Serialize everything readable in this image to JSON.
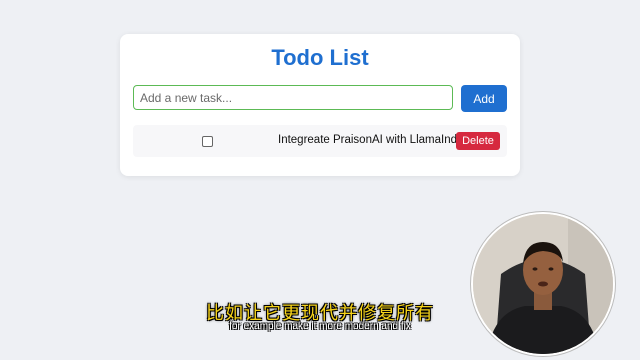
{
  "app": {
    "title": "Todo List",
    "accent_color": "#1f6fd0",
    "danger_color": "#d6293f"
  },
  "input": {
    "placeholder": "Add a new task...",
    "value": ""
  },
  "add_button": {
    "label": "Add"
  },
  "todos": [
    {
      "text": "Integreate PraisonAI with LlamaIndex",
      "done": false,
      "delete_label": "Delete"
    }
  ],
  "subtitles": {
    "chinese": "比如让它更现代并修复所有",
    "english": "for example make it more modern and fix"
  }
}
